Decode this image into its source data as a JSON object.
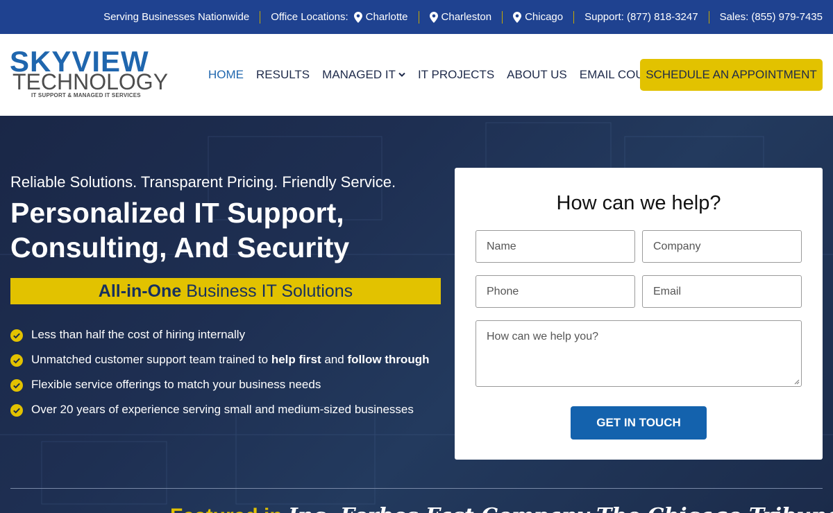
{
  "topbar": {
    "serving": "Serving Businesses Nationwide",
    "office_label": "Office Locations:",
    "locations": [
      "Charlotte",
      "Charleston",
      "Chicago"
    ],
    "support": "Support: (877) 818-3247",
    "sales": "Sales: (855) 979-7435"
  },
  "logo": {
    "line1": "SKYVIEW",
    "line2": "TECHNOLOGY",
    "line3": "IT SUPPORT & MANAGED IT SERVICES"
  },
  "nav": {
    "items": [
      "HOME",
      "RESULTS",
      "MANAGED IT",
      "IT PROJECTS",
      "ABOUT US",
      "EMAIL COURSE"
    ],
    "cta": "SCHEDULE AN APPOINTMENT"
  },
  "hero": {
    "tagline": "Reliable Solutions. Transparent Pricing. Friendly Service.",
    "headline_1": "Personalized IT Support,",
    "headline_2": "Consulting, And Security",
    "banner_bold": "All-in-One",
    "banner_rest": "Business IT Solutions",
    "bullets": [
      {
        "text": "Less than half the cost of hiring internally"
      },
      {
        "pre": "Unmatched customer support team trained to ",
        "b1": "help first",
        "mid": " and ",
        "b2": "follow through"
      },
      {
        "text": "Flexible service offerings to match your business needs"
      },
      {
        "text": "Over 20 years of experience serving small and medium-sized businesses"
      }
    ]
  },
  "form": {
    "title": "How can we help?",
    "name_placeholder": "Name",
    "company_placeholder": "Company",
    "phone_placeholder": "Phone",
    "email_placeholder": "Email",
    "message_placeholder": "How can we help you?",
    "submit": "GET IN TOUCH"
  },
  "bottom": {
    "yellow": "Featured in",
    "white": "Inc. Forbes Fast Company The Chicago Tribune"
  },
  "colors": {
    "topbar": "#1f4290",
    "accent_yellow": "#e2c200",
    "brand_blue": "#1f66ae",
    "button_blue": "#1462ad"
  }
}
